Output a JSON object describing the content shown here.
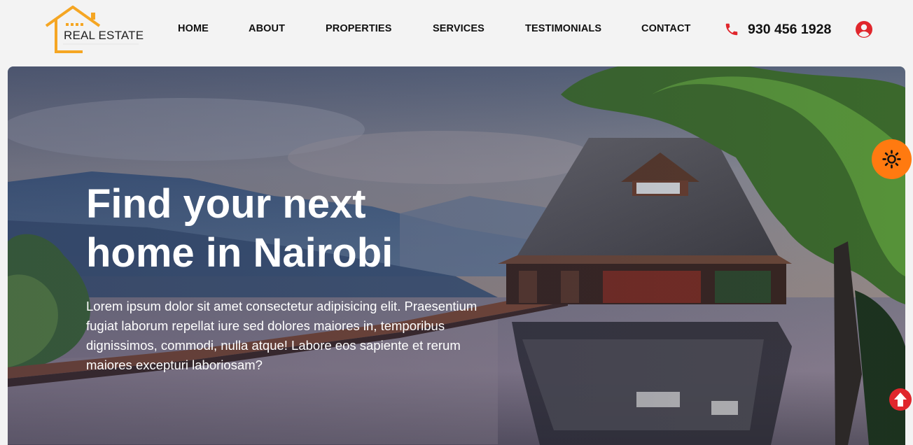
{
  "header": {
    "logo": {
      "text": "REAL ESTATE",
      "tagline": ""
    },
    "nav": [
      {
        "label": "HOME"
      },
      {
        "label": "ABOUT"
      },
      {
        "label": "PROPERTIES"
      },
      {
        "label": "SERVICES"
      },
      {
        "label": "TESTIMONIALS"
      },
      {
        "label": "CONTACT"
      }
    ],
    "phone": "930 456 1928",
    "icons": {
      "phone": "phone-icon",
      "user": "user-account-icon"
    }
  },
  "hero": {
    "title": "Find your next home in Nairobi",
    "text": "Lorem ipsum dolor sit amet consectetur adipisicing elit. Praesentium fugiat laborum repellat iure sed dolores maiores in, temporibus dignissimos, commodi, nulla atque! Labore eos sapiente et rerum maiores excepturi laboriosam?"
  },
  "floating": {
    "theme_toggle_icon": "sun-icon",
    "scroll_top_icon": "arrow-up-circle-icon"
  },
  "colors": {
    "accent": "#f5a623",
    "phone_red": "#e0262c",
    "theme_orange": "#ff7a10",
    "header_bg": "#f3f3f3"
  }
}
